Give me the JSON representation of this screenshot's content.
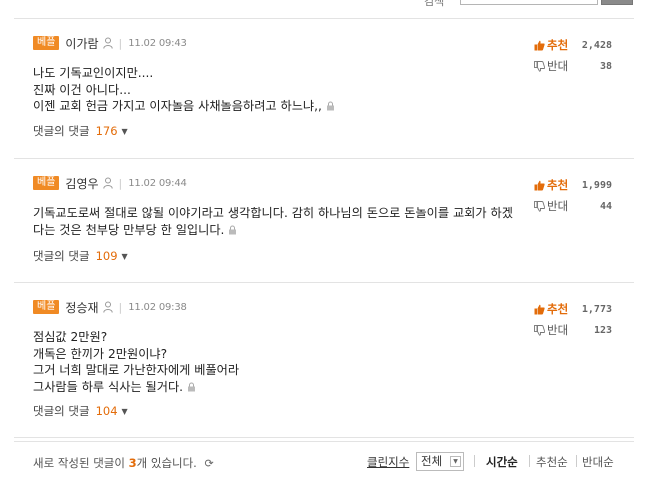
{
  "search": {
    "label": "검색",
    "button_label": "검색"
  },
  "comments": [
    {
      "badge": "베플",
      "author": "이가람",
      "time": "11.02 09:43",
      "lines": [
        "나도 기독교인이지만....",
        "진짜 이건 아니다...",
        "이젠 교회 헌금 가지고 이자놀음 사채놀음하려고 하느냐,,"
      ],
      "replies_label": "댓글의 댓글",
      "replies_count": "176",
      "up_label": "추천",
      "up_count": "2,428",
      "down_label": "반대",
      "down_count": "38"
    },
    {
      "badge": "베플",
      "author": "김영우",
      "time": "11.02 09:44",
      "lines": [
        "기독교도로써 절대로 않될 이야기라고 생각합니다. 감히 하나님의 돈으로 돈놀이를 교회가 하겠다는 것은 천부당 만부당 한 일입니다."
      ],
      "replies_label": "댓글의 댓글",
      "replies_count": "109",
      "up_label": "추천",
      "up_count": "1,999",
      "down_label": "반대",
      "down_count": "44"
    },
    {
      "badge": "베플",
      "author": "정승재",
      "time": "11.02 09:38",
      "lines": [
        "점심값 2만원?",
        "개독은 한끼가 2만원이냐?",
        "그거 너희 말대로 가난한자에게 베풀어라",
        "그사람들 하루 식사는 될거다."
      ],
      "replies_label": "댓글의 댓글",
      "replies_count": "104",
      "up_label": "추천",
      "up_count": "1,773",
      "down_label": "반대",
      "down_count": "123"
    }
  ],
  "footer": {
    "new_prefix": "새로 작성된 댓글이 ",
    "new_count": "3",
    "new_suffix": "개 있습니다.",
    "clean_label": "클린지수",
    "select_value": "전체",
    "sort": [
      "시간순",
      "추천순",
      "반대순"
    ]
  },
  "colors": {
    "accent": "#e36c0a",
    "badge": "#f08a24"
  },
  "icons": [
    "user-icon",
    "lock-icon",
    "thumb-up-icon",
    "thumb-down-icon",
    "refresh-icon",
    "chevron-down-icon"
  ]
}
